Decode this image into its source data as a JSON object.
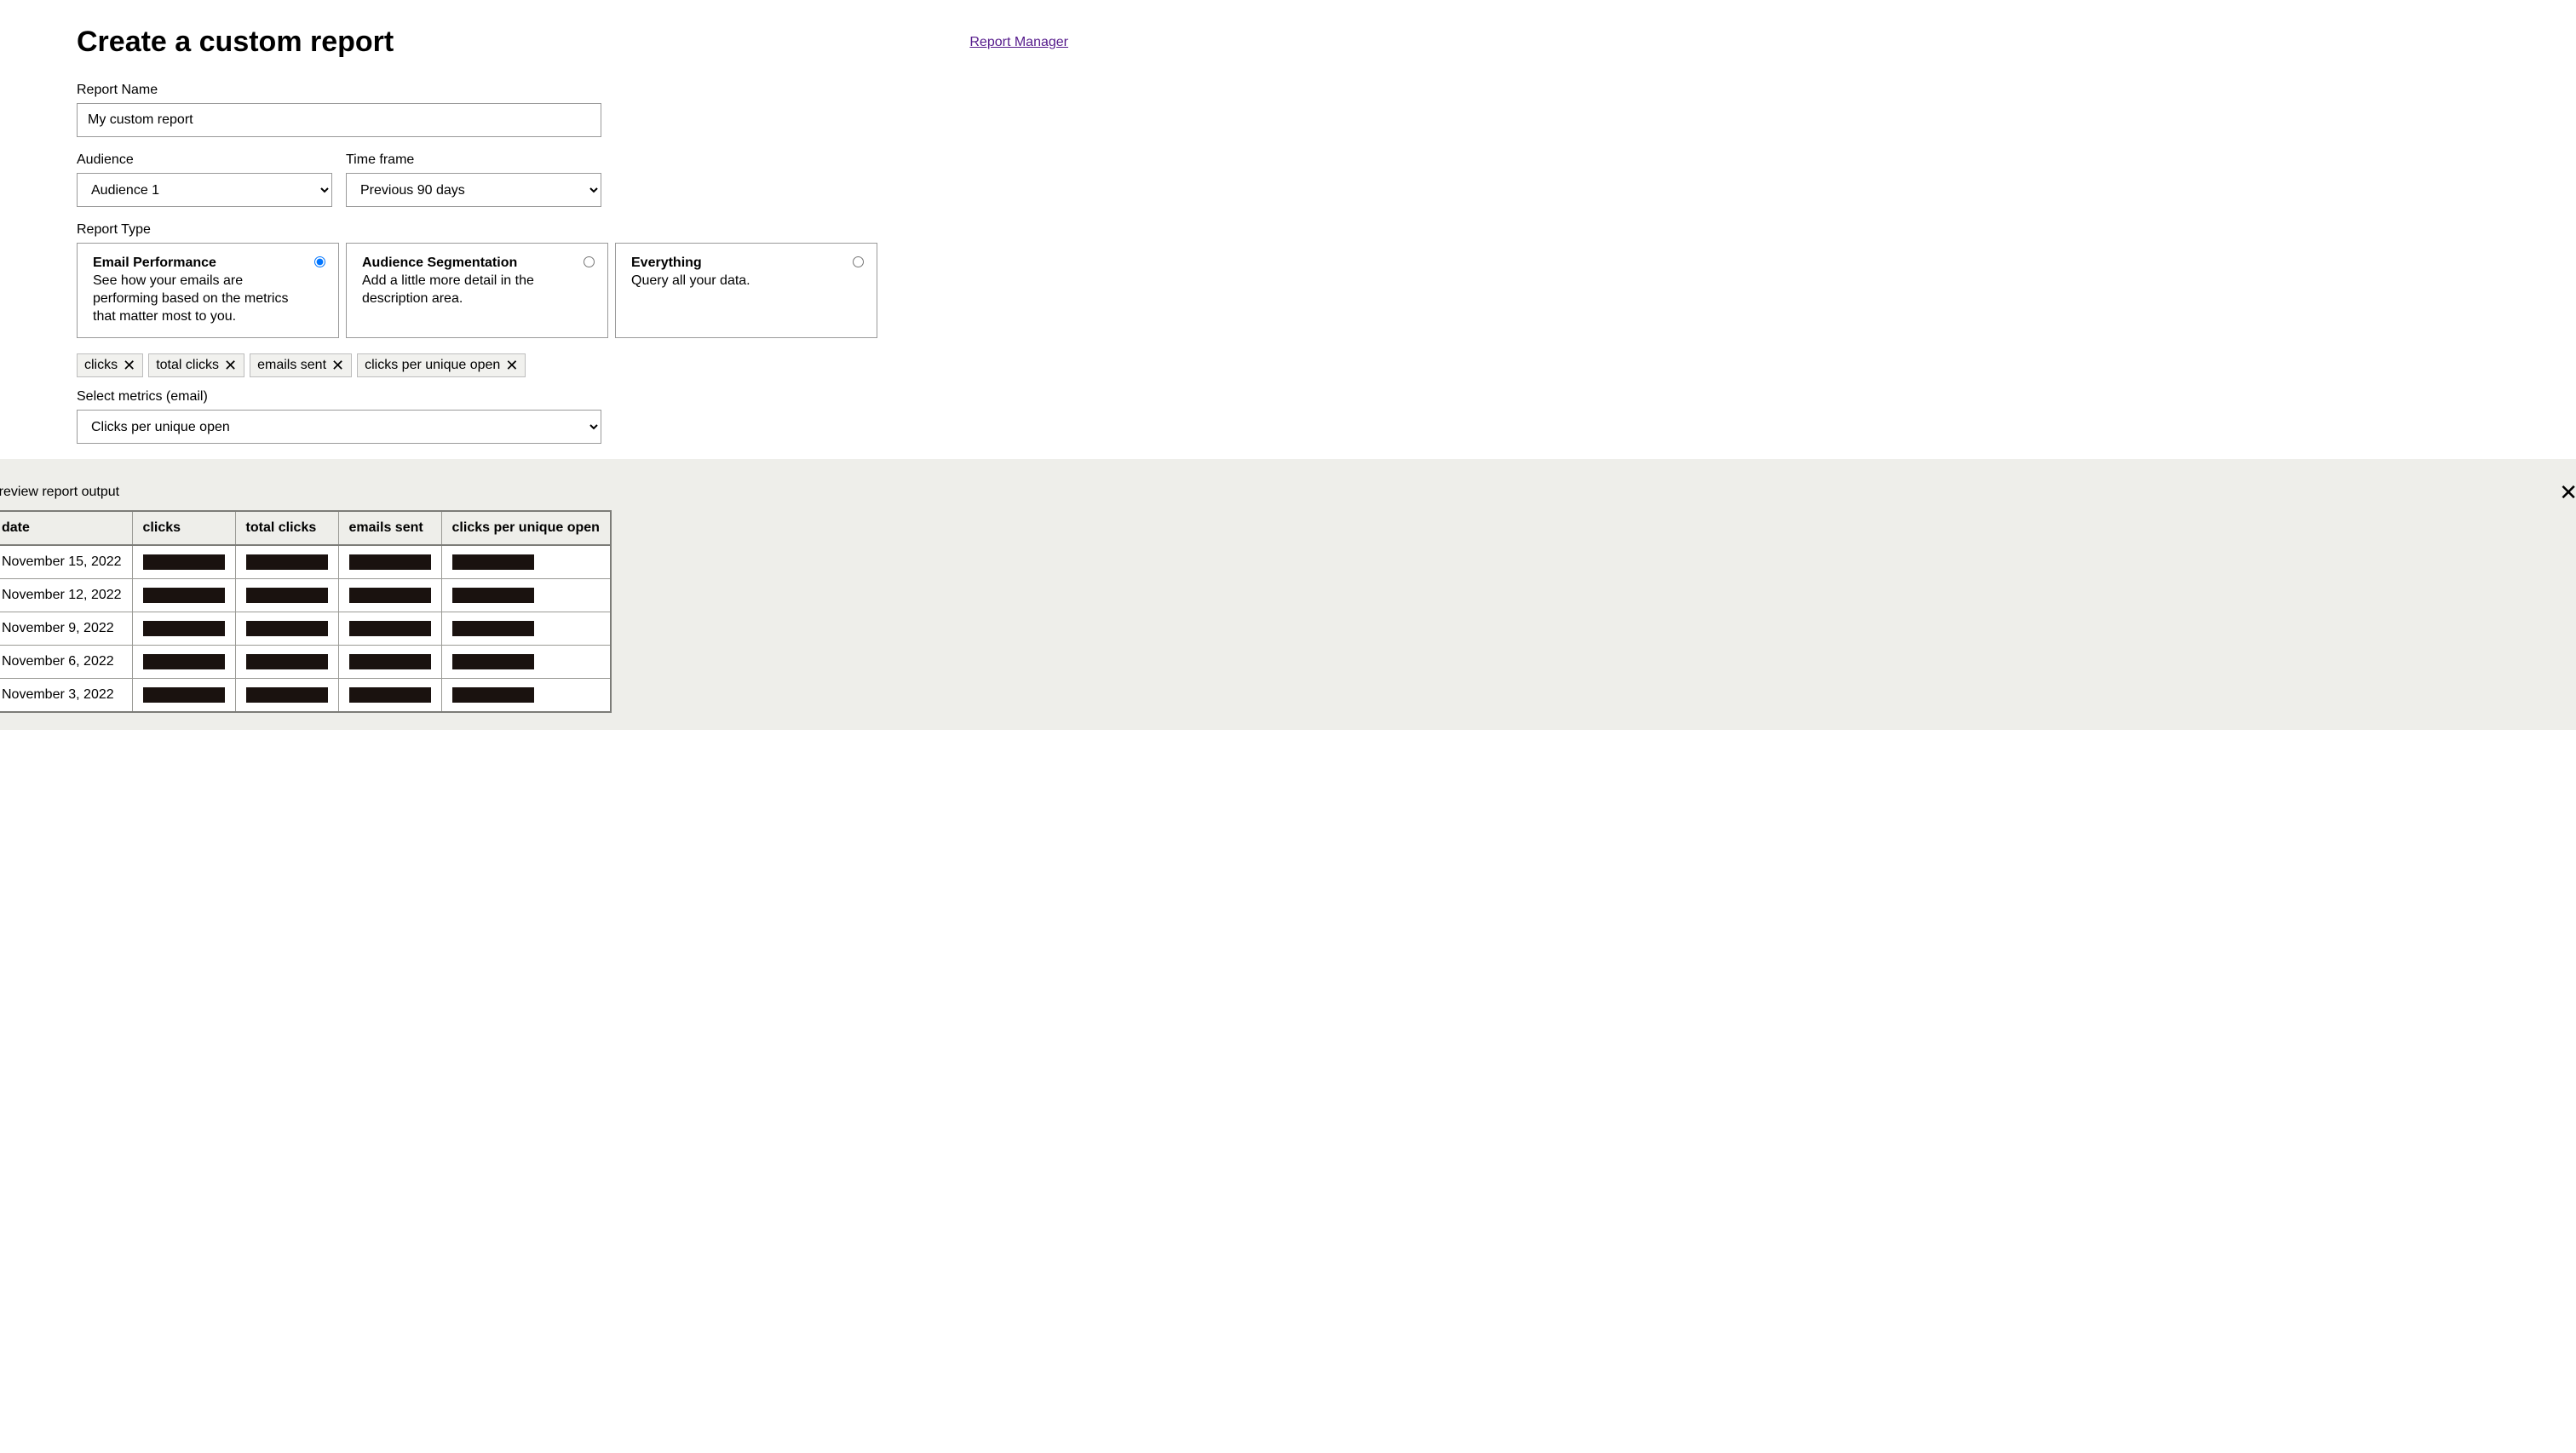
{
  "header": {
    "title": "Create a custom report",
    "manager_link": "Report Manager"
  },
  "form": {
    "report_name_label": "Report Name",
    "report_name_value": "My custom report",
    "audience_label": "Audience",
    "audience_value": "Audience 1",
    "audience_options": [
      "Audience 1"
    ],
    "time_frame_label": "Time frame",
    "time_frame_value": "Previous 90 days",
    "time_frame_options": [
      "Previous 90 days"
    ],
    "report_type_label": "Report Type",
    "report_types": [
      {
        "title": "Email Performance",
        "desc": "See how your emails are performing based on the metrics that matter most to you.",
        "selected": true
      },
      {
        "title": "Audience Segmentation",
        "desc": "Add a little more detail in the description area.",
        "selected": false
      },
      {
        "title": "Everything",
        "desc": "Query all your data.",
        "selected": false
      }
    ],
    "chips": [
      "clicks",
      "total clicks",
      "emails sent",
      "clicks per unique open"
    ],
    "metrics_label": "Select metrics (email)",
    "metrics_value": "Clicks per unique open",
    "metrics_options": [
      "Clicks per unique open"
    ]
  },
  "preview": {
    "label": "Preview report output",
    "columns": [
      "date",
      "clicks",
      "total clicks",
      "emails sent",
      "clicks per unique open"
    ],
    "rows": [
      {
        "date": "November 15, 2022"
      },
      {
        "date": "November 12, 2022"
      },
      {
        "date": "November 9, 2022"
      },
      {
        "date": "November 6, 2022"
      },
      {
        "date": "November 3, 2022"
      }
    ]
  }
}
